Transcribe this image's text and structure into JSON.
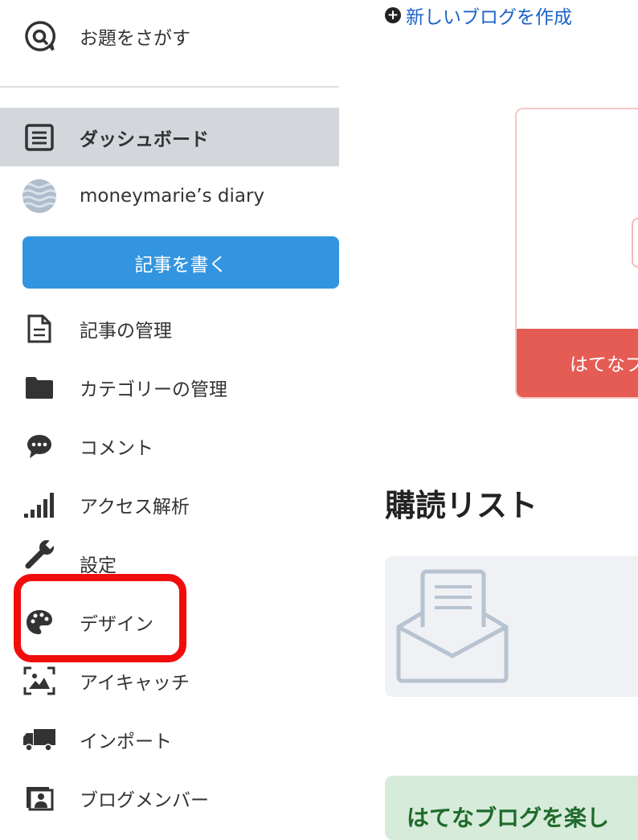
{
  "sidebar": {
    "search": {
      "label": "お題をさがす",
      "icon": "search-speech-icon"
    },
    "dashboard": {
      "label": "ダッシュボード",
      "icon": "dashboard-icon"
    },
    "blog": {
      "name": "moneymarie’s diary",
      "icon": "blog-avatar"
    },
    "write_button": "記事を書く",
    "items": [
      {
        "label": "記事の管理",
        "icon": "document-icon"
      },
      {
        "label": "カテゴリーの管理",
        "icon": "folder-icon"
      },
      {
        "label": "コメント",
        "icon": "comment-icon"
      },
      {
        "label": "アクセス解析",
        "icon": "signal-bars-icon"
      },
      {
        "label": "設定",
        "icon": "wrench-icon"
      },
      {
        "label": "デザイン",
        "icon": "palette-icon"
      },
      {
        "label": "アイキャッチ",
        "icon": "eyecatch-image-icon"
      },
      {
        "label": "インポート",
        "icon": "truck-icon"
      },
      {
        "label": "ブログメンバー",
        "icon": "member-icon"
      }
    ]
  },
  "main": {
    "new_blog_link": "新しいブログを作成",
    "promo_bar_text": "はてなブ",
    "subscription_title": "購読リスト",
    "green_card_text": "はてなブログを楽し"
  },
  "colors": {
    "accent_blue": "#3395e0",
    "link_blue": "#1d64c6",
    "highlight_red": "#f20d0d",
    "promo_red": "#e55c55",
    "dashboard_bg": "#d3d7dc"
  }
}
